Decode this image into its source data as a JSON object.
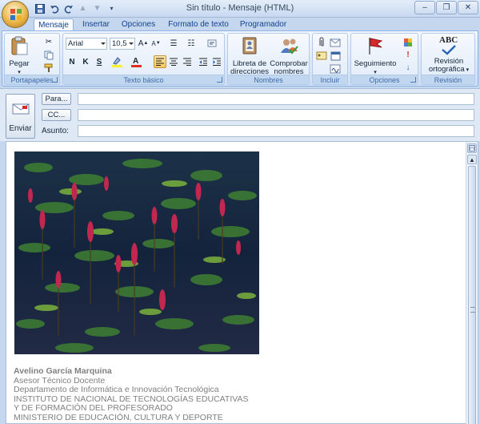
{
  "window": {
    "title": "Sin título - Mensaje (HTML)",
    "controls": [
      "‒",
      "❐",
      "✕"
    ]
  },
  "quick_access": [
    "save-icon",
    "undo-icon",
    "redo-icon",
    "up-arrow-icon",
    "down-arrow-icon",
    "more-icon"
  ],
  "tabs": [
    {
      "label": "Mensaje",
      "active": true
    },
    {
      "label": "Insertar"
    },
    {
      "label": "Opciones"
    },
    {
      "label": "Formato de texto"
    },
    {
      "label": "Programador"
    }
  ],
  "ribbon": {
    "clipboard": {
      "label": "Portapapeles",
      "paste": "Pegar"
    },
    "basic_text": {
      "label": "Texto básico",
      "font": "Arial",
      "size": "10,5",
      "bold": "N",
      "italic": "K",
      "underline": "S"
    },
    "names": {
      "label": "Nombres",
      "address_book": [
        "Libreta de",
        "direcciones"
      ],
      "check_names": [
        "Comprobar",
        "nombres"
      ]
    },
    "include": {
      "label": "Incluir"
    },
    "options": {
      "label": "Opciones",
      "follow_up": "Seguimiento"
    },
    "review": {
      "label": "Revisión",
      "spelling": [
        "Revisión",
        "ortográfica"
      ],
      "abc": "ABC"
    }
  },
  "header": {
    "send": "Enviar",
    "to": "Para...",
    "cc": "CC...",
    "subject": "Asunto:"
  },
  "signature": {
    "name": "Avelino García Marquina",
    "role": "Asesor Técnico Docente",
    "dept": "Departamento de Informática e Innovación Tecnológica",
    "inst1": "INSTITUTO DE NACIONAL DE TECNOLOGÍAS EDUCATIVAS",
    "inst2": "Y DE FORMACIÓN DEL PROFESORADO",
    "ministry": "MINISTERIO DE EDUCACIÓN, CULTURA Y DEPORTE"
  }
}
